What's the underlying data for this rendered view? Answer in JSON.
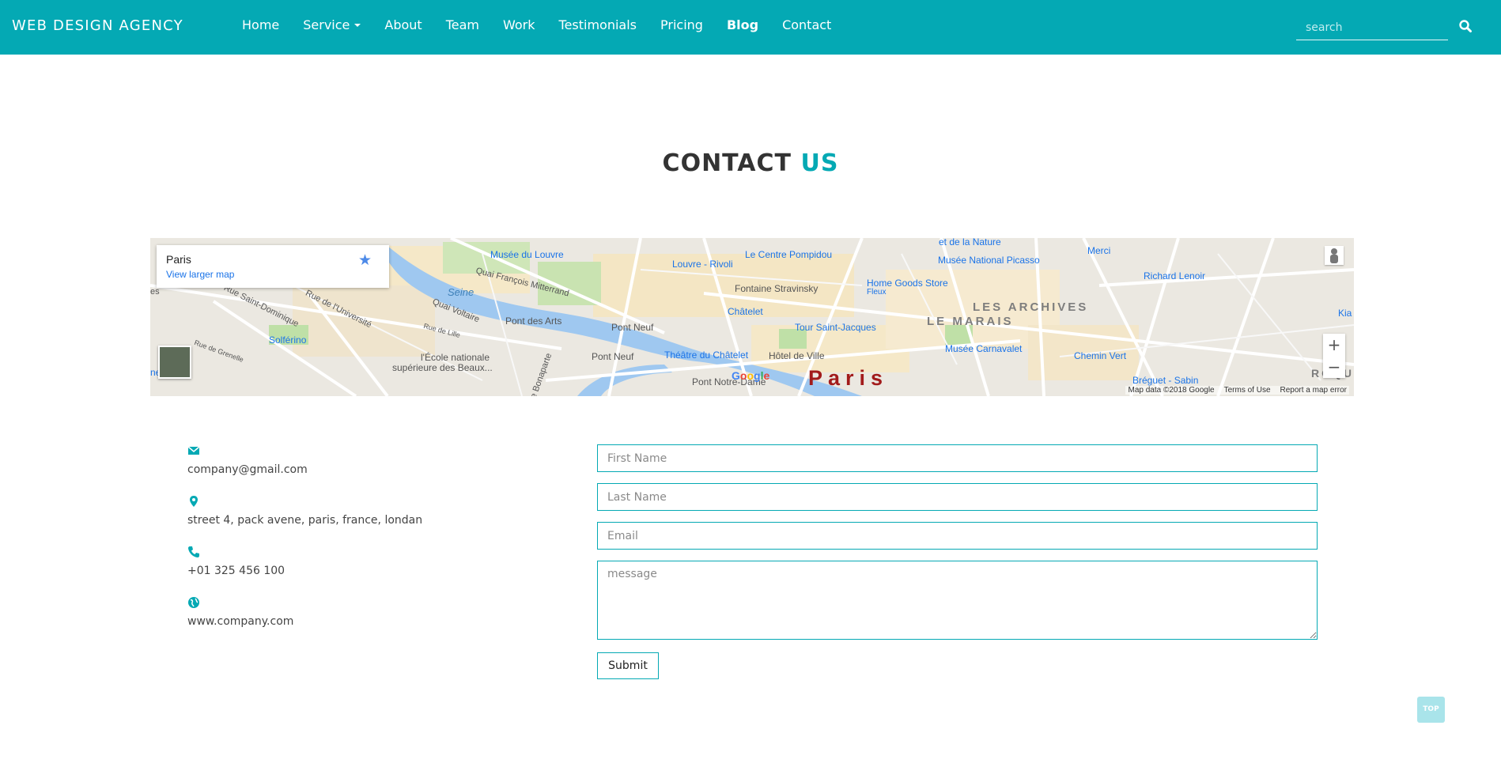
{
  "navbar": {
    "brand": "WEB DESIGN AGENCY",
    "items": [
      {
        "label": "Home"
      },
      {
        "label": "Service"
      },
      {
        "label": "About"
      },
      {
        "label": "Team"
      },
      {
        "label": "Work"
      },
      {
        "label": "Testimonials"
      },
      {
        "label": "Pricing"
      },
      {
        "label": "Blog"
      },
      {
        "label": "Contact"
      }
    ],
    "active": "Blog",
    "search_placeholder": "search",
    "search_icon": "search-icon"
  },
  "title": {
    "main": "CONTACT",
    "accent": "US"
  },
  "map": {
    "place": "Paris",
    "larger_map": "View larger map",
    "city": "Paris",
    "zoom_in": "+",
    "zoom_out": "−",
    "google": "Google",
    "attribution": [
      "Map data ©2018 Google",
      "Terms of Use",
      "Report a map error"
    ],
    "labels": {
      "louvre": "Musée du Louvre",
      "louvre_rivoli": "Louvre - Rivoli",
      "pompidou": "Le Centre Pompidou",
      "picasso": "Musée National Picasso",
      "merci": "Merci",
      "stravinsky": "Fontaine Stravinsky",
      "home_goods": "Home Goods Store",
      "fleux": "Fleux",
      "archives": "LES ARCHIVES",
      "marais": "LE MARAIS",
      "richard": "Richard Lenoir",
      "chatelet": "Châtelet",
      "tour": "Tour Saint-Jacques",
      "carnavalet": "Musée Carnavalet",
      "seine": "Seine",
      "mitterrand": "Quai François Mitterrand",
      "voltaire": "Quai Voltaire",
      "arts": "Pont des Arts",
      "pont_neuf_m": "Pont Neuf",
      "pont_neuf": "Pont Neuf",
      "theatre": "Théâtre du Châtelet",
      "hotel": "Hôtel de Ville",
      "chemin": "Chemin Vert",
      "breguet": "Bréguet - Sabin",
      "solferino": "Solférino",
      "ecole": "l'École nationale",
      "beaux": "supérieure des Beaux...",
      "notre_dame": "Pont Notre-Dame",
      "st_dominique": "Rue Saint-Dominique",
      "universite": "Rue de l'Université",
      "lille": "Rue de Lille",
      "grenelle": "Rue de Grenelle",
      "bonaparte": "Rue Bonaparte",
      "vielle": "et de la Nature",
      "rue": "Rue",
      "roqu": "ROQU",
      "kia": "Kia",
      "ne": "ne",
      "es": "es"
    }
  },
  "contact": {
    "email": "company@gmail.com",
    "address": "street 4, pack avene, paris, france, londan",
    "phone": "+01 325 456 100",
    "website": "www.company.com",
    "icons": [
      "envelope-icon",
      "map-marker-icon",
      "phone-icon",
      "globe-icon"
    ]
  },
  "form": {
    "first_name": "First Name",
    "last_name": "Last Name",
    "email": "Email",
    "message": "message",
    "submit": "Submit"
  },
  "colors": {
    "accent": "#04a9b4",
    "top_button": "#a9e4ea",
    "city_label": "#a21b1b",
    "map_poi": "#1a73e8"
  },
  "top_button": "TOP"
}
